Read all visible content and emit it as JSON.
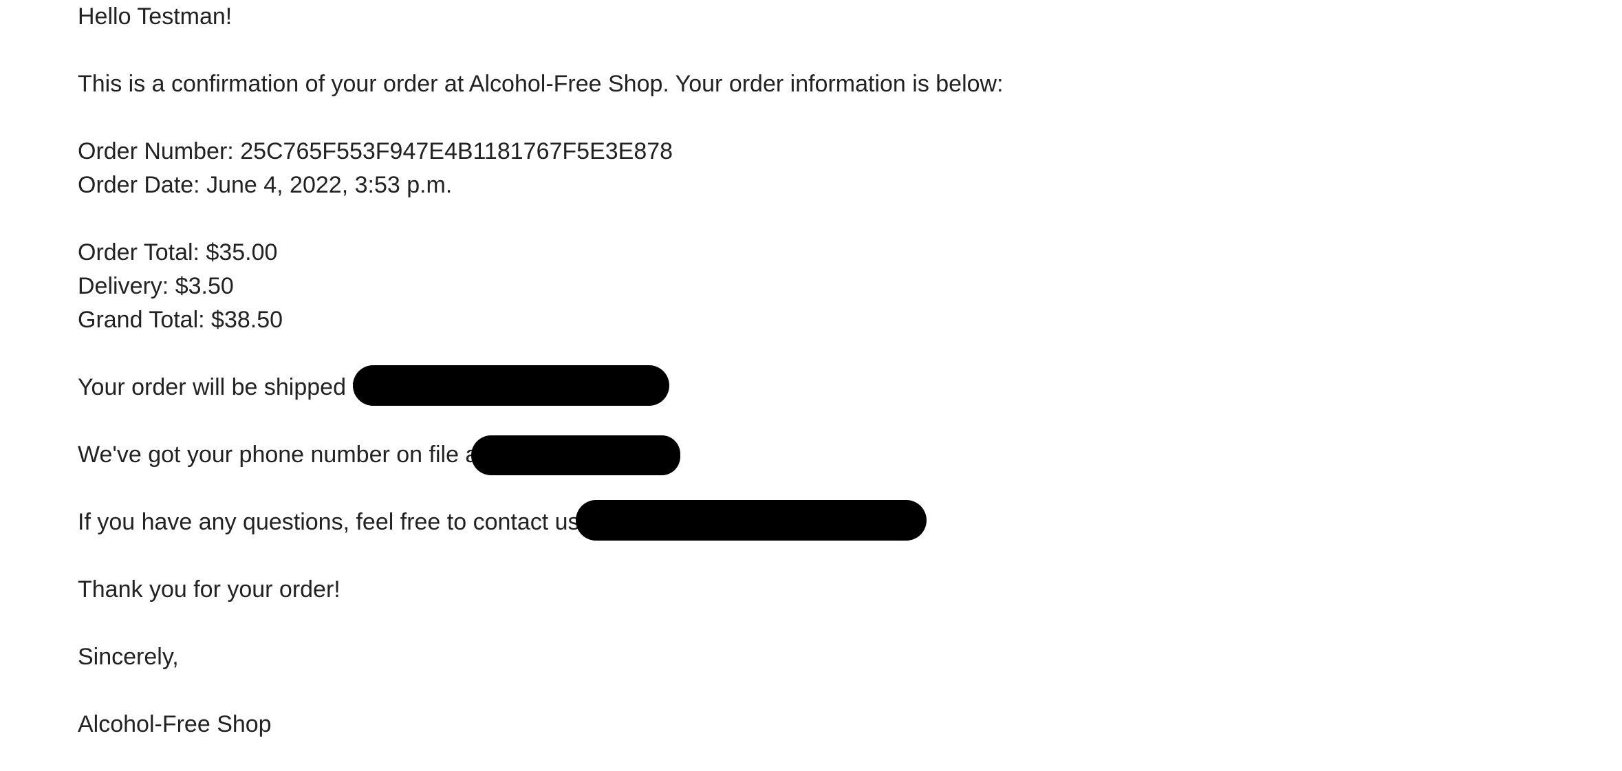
{
  "email": {
    "greeting": "Hello Testman!",
    "intro": "This is a confirmation of your order at Alcohol-Free Shop. Your order information is below:",
    "order_number_label": "Order Number: ",
    "order_number": "25C765F553F947E4B1181767F5E3E878",
    "order_date_label": "Order Date: ",
    "order_date": "June 4, 2022, 3:53 p.m.",
    "order_total_label": "Order Total: ",
    "order_total": "$35.00",
    "delivery_label": "Delivery: ",
    "delivery": "$3.50",
    "grand_total_label": "Grand Total: ",
    "grand_total": "$38.50",
    "shipping_text": "Your order will be shipped to",
    "phone_text": "We've got your phone number on file as",
    "contact_text": "If you have any questions, feel free to contact us at",
    "thanks": "Thank you for your order!",
    "closing": "Sincerely,",
    "signature": "Alcohol-Free Shop"
  }
}
